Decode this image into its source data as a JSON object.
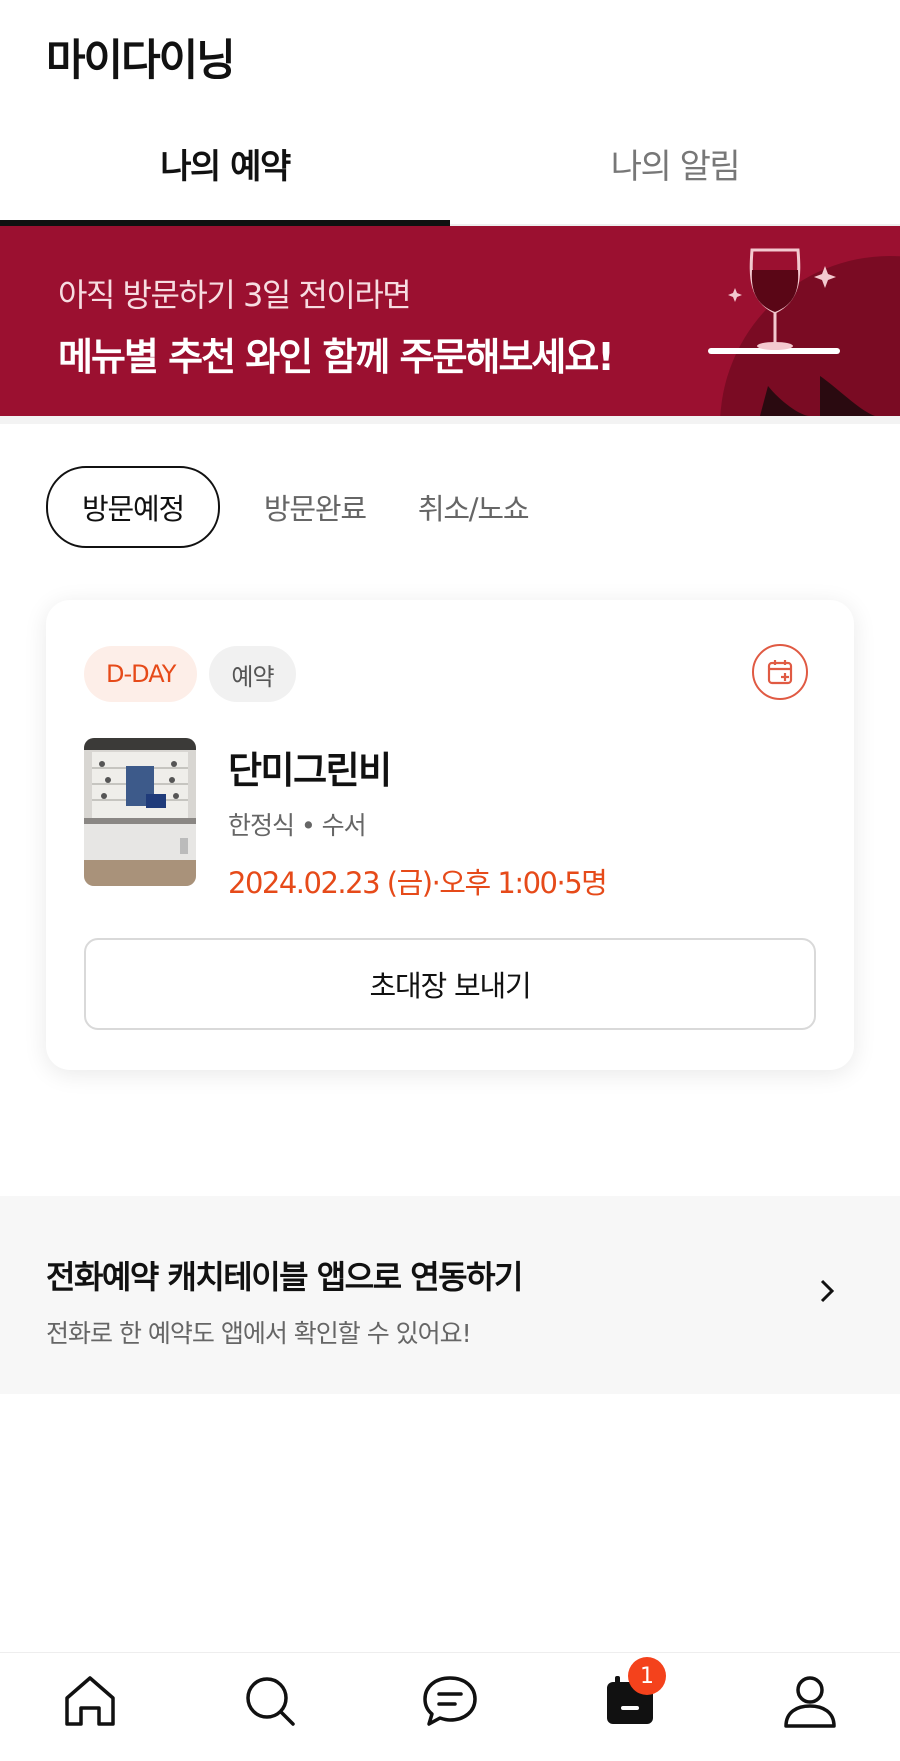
{
  "header": {
    "title": "마이다이닝"
  },
  "tabs": [
    {
      "label": "나의 예약",
      "active": true
    },
    {
      "label": "나의 알림",
      "active": false
    }
  ],
  "banner": {
    "subtitle": "아직 방문하기 3일 전이라면",
    "title": "메뉴별 추천 와인 함께 주문해보세요!",
    "bg_color": "#9b1030",
    "icon": "wine-glass-illustration"
  },
  "filters": [
    {
      "label": "방문예정",
      "active": true
    },
    {
      "label": "방문완료",
      "active": false
    },
    {
      "label": "취소/노쇼",
      "active": false
    }
  ],
  "reservation": {
    "badge_dday": "D-DAY",
    "badge_type": "예약",
    "calendar_icon": "calendar-add-icon",
    "store_name": "단미그린비",
    "store_meta": "한정식 • 수서",
    "datetime": "2024.02.23 (금)·오후 1:00·5명",
    "invite_button": "초대장 보내기"
  },
  "promo": {
    "title": "전화예약 캐치테이블 앱으로 연동하기",
    "subtitle": "전화로 한 예약도 앱에서 확인할 수 있어요!"
  },
  "bottom_nav": {
    "items": [
      "home-icon",
      "search-icon",
      "chat-icon",
      "calendar-icon",
      "profile-icon"
    ],
    "calendar_badge": "1",
    "accent_color": "#f4421c"
  }
}
